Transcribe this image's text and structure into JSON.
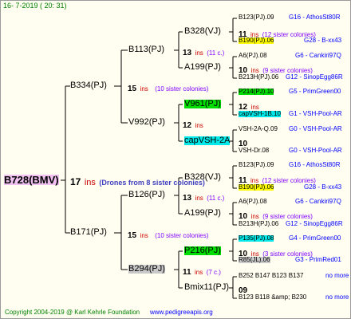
{
  "header": {
    "date": "16-  7-2019  ( 20:  31)"
  },
  "root": {
    "label": "B728(BMV)",
    "ins": "17",
    "ins_word": "ins",
    "note": "(Drones from 8 sister colonies)"
  },
  "gen1": [
    {
      "label": "B334(PJ)",
      "ins": "15",
      "ins_word": "ins",
      "note": "(10 sister colonies)"
    },
    {
      "label": "B171(PJ)",
      "ins": "15",
      "ins_word": "ins",
      "note": "(10 sister colonies)"
    }
  ],
  "gen2": [
    {
      "label": "B113(PJ)",
      "ins": "13",
      "ins_word": "ins",
      "note": "(11 c.)"
    },
    {
      "label": "V992(PJ)",
      "ins": "12",
      "ins_word": "ins"
    },
    {
      "label": "B126(PJ)",
      "ins": "13",
      "ins_word": "ins",
      "note": "(11 c.)"
    },
    {
      "label": "B294(PJ)",
      "ins": "11",
      "ins_word": "ins",
      "note": "(7 c.)"
    }
  ],
  "gen3": [
    {
      "label": "B328(VJ)",
      "ins": "11",
      "ins_word": "ins",
      "note": "(12 sister colonies)"
    },
    {
      "label": "A199(PJ)",
      "ins": "10",
      "ins_word": "ins",
      "note": "(9 sister colonies)"
    },
    {
      "label": "V961(PJ)",
      "ins": "12",
      "ins_word": "ins"
    },
    {
      "label": "capVSH-2A",
      "ins": "10"
    },
    {
      "label": "B328(VJ)",
      "ins": "11",
      "ins_word": "ins",
      "note": "(12 sister colonies)"
    },
    {
      "label": "A199(PJ)",
      "ins": "10",
      "ins_word": "ins",
      "note": "(9 sister colonies)"
    },
    {
      "label": "P216(PJ)",
      "ins": "10",
      "ins_word": "ins",
      "note": "(3 sister colonies)"
    },
    {
      "label": "Bmix11(PJ)",
      "ins": "09"
    }
  ],
  "gen4": [
    {
      "a": "B123(PJ).09",
      "b": "G16 - AthosSt80R"
    },
    {
      "a": "B190(PJ).06",
      "b": "G28 - B-xx43"
    },
    {
      "a": "A6(PJ).08",
      "b": "G6 - Cankiri97Q"
    },
    {
      "a": "B213H(PJ).06",
      "b": "G12 - SinopEgg86R"
    },
    {
      "a": "P214(PJ).10",
      "b": "G5 - PrimGreen00"
    },
    {
      "a": "capVSH-1B.10",
      "b": "G1 - VSH-Pool-AR"
    },
    {
      "a": "VSH-2A-Q.09",
      "b": "G0 - VSH-Pool-AR"
    },
    {
      "a": "VSH-Dr.08",
      "b": "G0 - VSH-Pool-AR"
    },
    {
      "a": "B123(PJ).09",
      "b": "G16 - AthosSt80R"
    },
    {
      "a": "B190(PJ).06",
      "b": "G28 - B-xx43"
    },
    {
      "a": "A6(PJ).08",
      "b": "G6 - Cankiri97Q"
    },
    {
      "a": "B213H(PJ).06",
      "b": "G12 - SinopEgg86R"
    },
    {
      "a": "P135(PJ).08",
      "b": "G4 - PrimGreen00"
    },
    {
      "a": "R85(JL).06",
      "b": "G3 - PrimRed01"
    },
    {
      "a": "B252 B147 B123 B137",
      "b": "no more"
    },
    {
      "a": "B123 B118 &amp; B230",
      "b": "no more"
    }
  ],
  "footer": {
    "copyright": "Copyright 2004-2019 @ Karl Kehrle Foundation",
    "url": "www.pedigreeapis.org"
  },
  "watermark": "apis"
}
